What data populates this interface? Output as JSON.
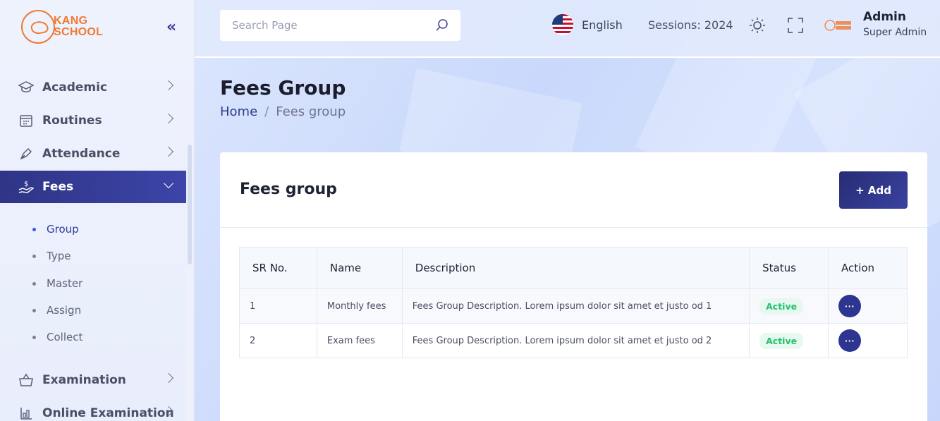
{
  "brand": {
    "line1": "KANG",
    "line2": "SCHOOL",
    "color": "#f07a33"
  },
  "sidebar": {
    "items": [
      {
        "label": "Academic",
        "icon": "graduation-cap-icon"
      },
      {
        "label": "Routines",
        "icon": "calendar-icon"
      },
      {
        "label": "Attendance",
        "icon": "pen-icon"
      },
      {
        "label": "Fees",
        "icon": "money-hand-icon"
      },
      {
        "label": "Examination",
        "icon": "basket-icon"
      },
      {
        "label": "Online Examination",
        "icon": "chart-icon"
      }
    ],
    "fees_sub": [
      "Group",
      "Type",
      "Master",
      "Assign",
      "Collect"
    ]
  },
  "header": {
    "search_placeholder": "Search Page",
    "language": "English",
    "session": "Sessions: 2024",
    "user_name": "Admin",
    "user_role": "Super Admin"
  },
  "page": {
    "title": "Fees Group",
    "breadcrumb_home": "Home",
    "breadcrumb_sep": "/",
    "breadcrumb_current": "Fees group"
  },
  "card": {
    "title": "Fees group",
    "add_label": "+ Add",
    "columns": [
      "SR No.",
      "Name",
      "Description",
      "Status",
      "Action"
    ],
    "rows": [
      {
        "sr": "1",
        "name": "Monthly fees",
        "description": "Fees Group Description. Lorem ipsum dolor sit amet et justo od 1",
        "status": "Active",
        "action": "···"
      },
      {
        "sr": "2",
        "name": "Exam fees",
        "description": "Fees Group Description. Lorem ipsum dolor sit amet et justo od 2",
        "status": "Active",
        "action": "···"
      }
    ]
  },
  "colors": {
    "primary": "#2f3486",
    "active_status": "#22c26b"
  }
}
